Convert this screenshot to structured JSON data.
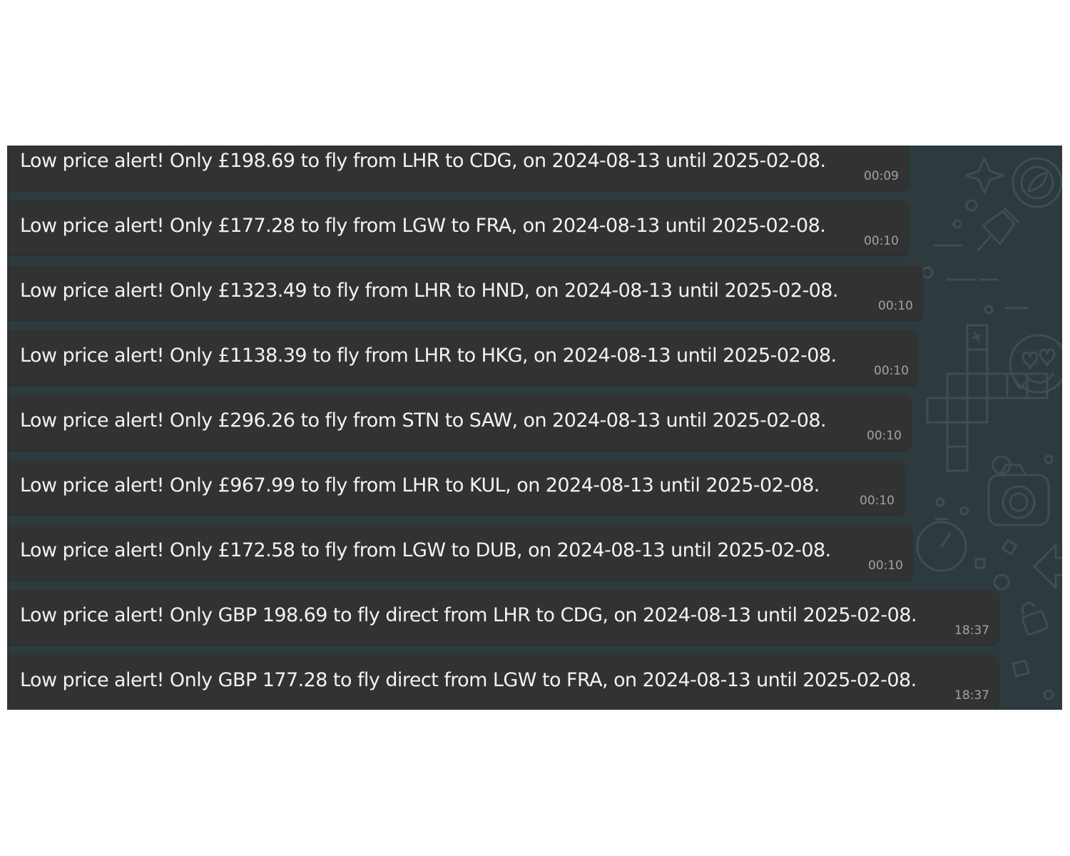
{
  "chat": {
    "messages": [
      {
        "text": "Low price alert! Only £198.69 to fly from LHR to CDG, on 2024-08-13 until 2025-02-08.",
        "time": "00:09"
      },
      {
        "text": "Low price alert! Only £177.28 to fly from LGW to FRA, on 2024-08-13 until 2025-02-08.",
        "time": "00:10"
      },
      {
        "text": "Low price alert! Only £1323.49 to fly from LHR to HND, on 2024-08-13 until 2025-02-08.",
        "time": "00:10"
      },
      {
        "text": "Low price alert! Only £1138.39 to fly from LHR to HKG, on 2024-08-13 until 2025-02-08.",
        "time": "00:10"
      },
      {
        "text": "Low price alert! Only £296.26 to fly from STN to SAW, on 2024-08-13 until 2025-02-08.",
        "time": "00:10"
      },
      {
        "text": "Low price alert! Only £967.99 to fly from LHR to KUL, on 2024-08-13 until 2025-02-08.",
        "time": "00:10"
      },
      {
        "text": "Low price alert! Only £172.58 to fly from LGW to DUB, on 2024-08-13 until 2025-02-08.",
        "time": "00:10"
      },
      {
        "text": "Low price alert! Only GBP 198.69 to fly direct from LHR to CDG, on 2024-08-13 until 2025-02-08.",
        "time": "18:37"
      },
      {
        "text": "Low price alert! Only GBP 177.28 to fly direct from LGW to FRA, on 2024-08-13 until 2025-02-08.",
        "time": "18:37"
      }
    ]
  },
  "colors": {
    "chat_background": "#2d3a3e",
    "bubble_background": "#323233",
    "message_text": "#f2f2f2",
    "timestamp_text": "#9ea3a6",
    "wallpaper_doodles": "#3f4e52"
  },
  "icons": [
    "sparkle-icon",
    "leaf-icon",
    "pushpin-icon",
    "crossword-icon",
    "heart-eyes-emoji-icon",
    "camera-icon",
    "stopwatch-icon",
    "arrow-icon",
    "lock-icon"
  ]
}
